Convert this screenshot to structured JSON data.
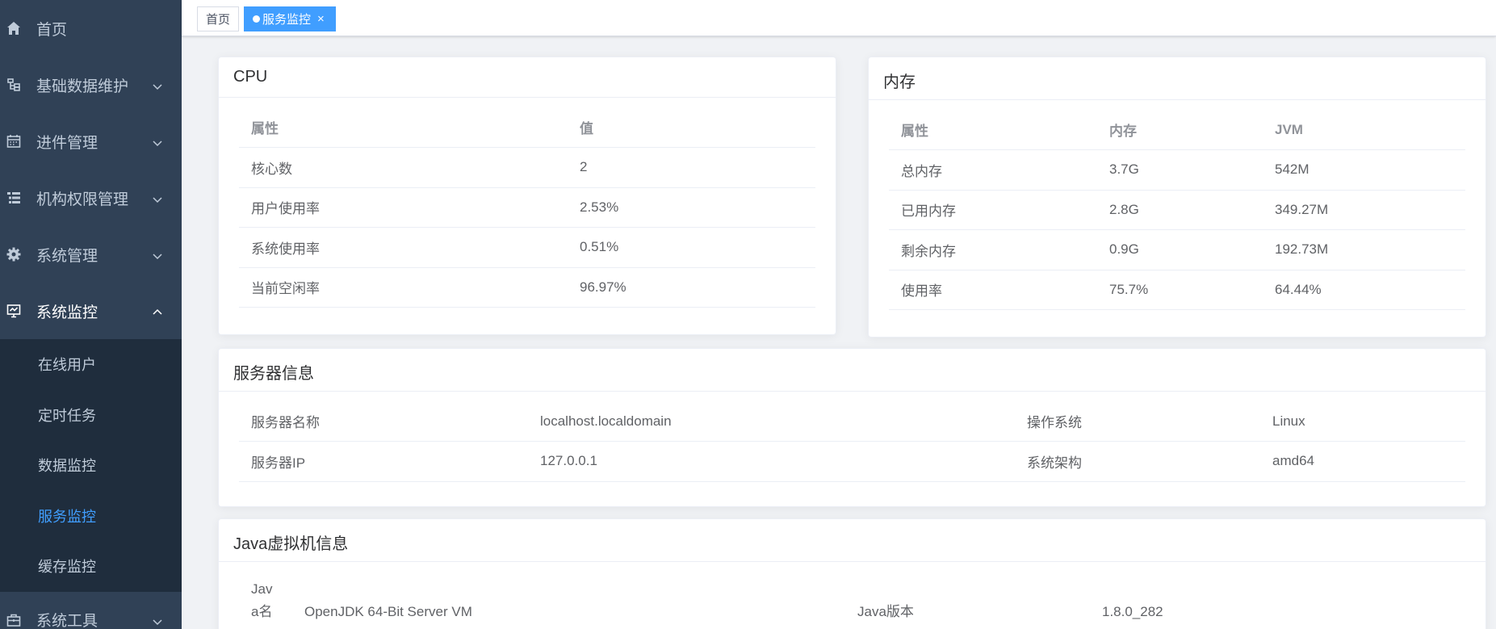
{
  "sidebar": {
    "items": [
      {
        "label": "首页",
        "icon": "home-icon"
      },
      {
        "label": "基础数据维护",
        "icon": "tree-icon"
      },
      {
        "label": "进件管理",
        "icon": "calendar-icon"
      },
      {
        "label": "机构权限管理",
        "icon": "tree-table-icon"
      },
      {
        "label": "系统管理",
        "icon": "gear-icon"
      },
      {
        "label": "系统监控",
        "icon": "monitor-icon"
      }
    ],
    "submenu": [
      {
        "label": "在线用户"
      },
      {
        "label": "定时任务"
      },
      {
        "label": "数据监控"
      },
      {
        "label": "服务监控"
      },
      {
        "label": "缓存监控"
      }
    ],
    "bottom_item": {
      "label": "系统工具",
      "icon": "toolbox-icon"
    }
  },
  "tags": {
    "home": "首页",
    "active": "服务监控",
    "close": "×"
  },
  "cpu": {
    "title": "CPU",
    "headers": [
      "属性",
      "值"
    ],
    "rows": [
      [
        "核心数",
        "2"
      ],
      [
        "用户使用率",
        "2.53%"
      ],
      [
        "系统使用率",
        "0.51%"
      ],
      [
        "当前空闲率",
        "96.97%"
      ]
    ]
  },
  "memory": {
    "title": "内存",
    "headers": [
      "属性",
      "内存",
      "JVM"
    ],
    "rows": [
      [
        "总内存",
        "3.7G",
        "542M"
      ],
      [
        "已用内存",
        "2.8G",
        "349.27M"
      ],
      [
        "剩余内存",
        "0.9G",
        "192.73M"
      ],
      [
        "使用率",
        "75.7%",
        "64.44%"
      ]
    ]
  },
  "server": {
    "title": "服务器信息",
    "rows": [
      [
        "服务器名称",
        "localhost.localdomain",
        "操作系统",
        "Linux"
      ],
      [
        "服务器IP",
        "127.0.0.1",
        "系统架构",
        "amd64"
      ]
    ]
  },
  "java": {
    "title": "Java虚拟机信息",
    "name_label_line1": "Jav",
    "name_label_line2": "a名",
    "name_value": "OpenJDK 64-Bit Server VM",
    "version_label": "Java版本",
    "version_value": "1.8.0_282"
  }
}
